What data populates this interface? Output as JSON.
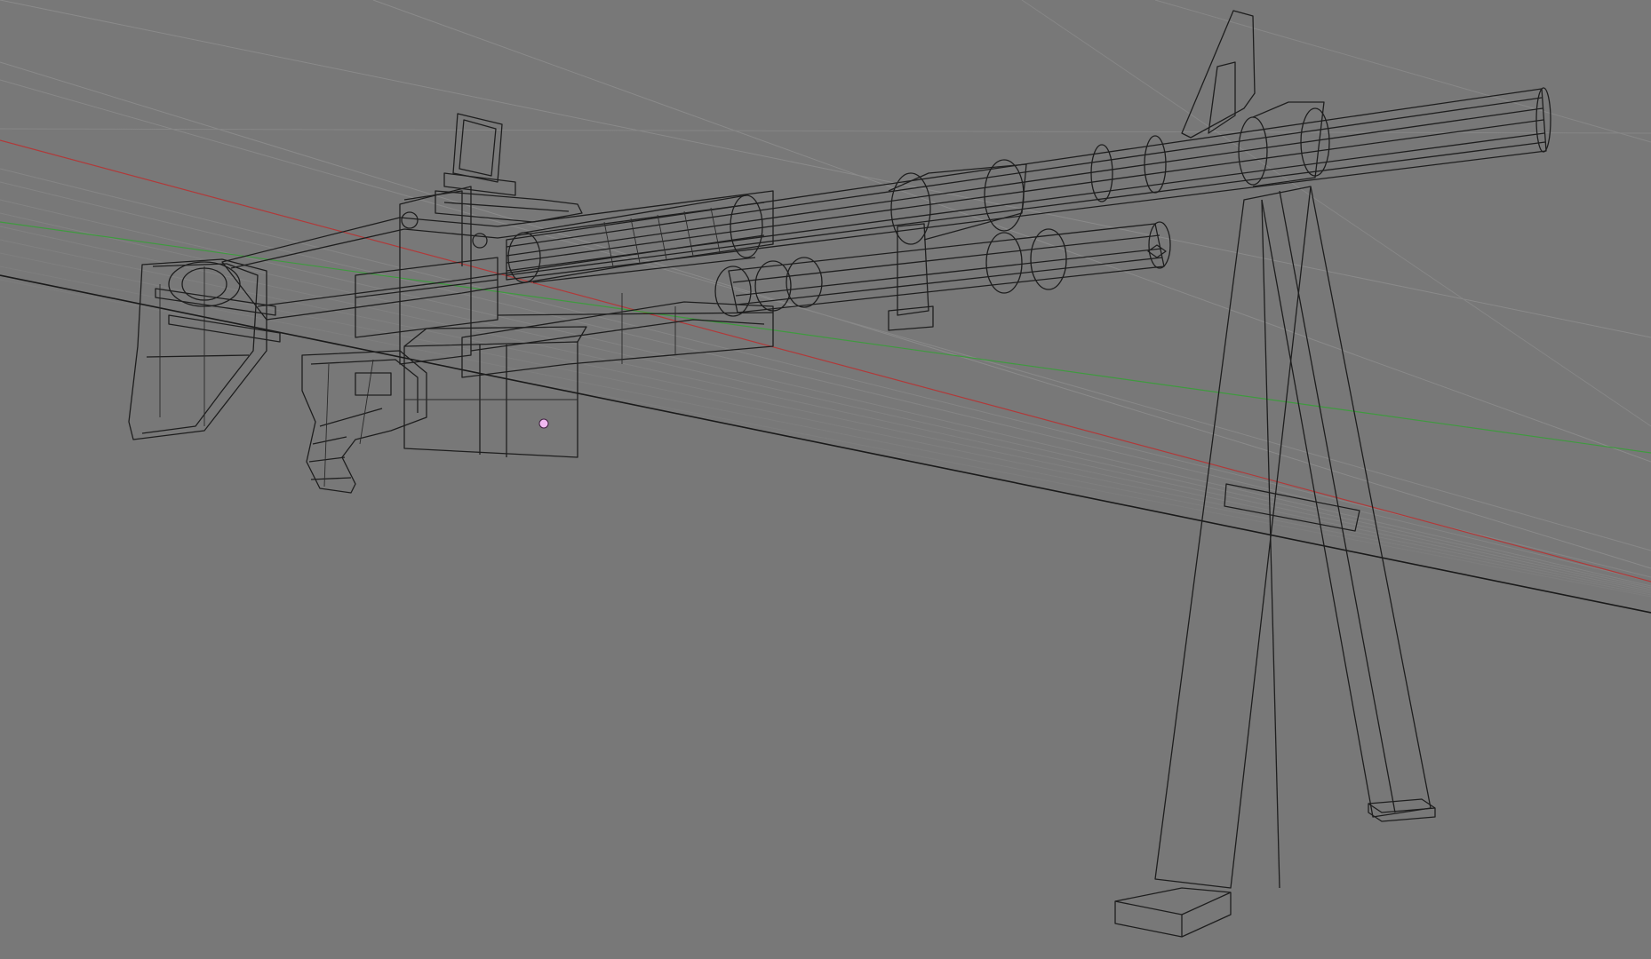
{
  "viewport": {
    "mode": "wireframe",
    "background_color": "#787878",
    "wire_color": "#1e1e1e",
    "axis_x_color": "#b03a3a",
    "axis_y_color": "#3f9a3f",
    "grid_color": "#8e8e8e",
    "horizon_color": "#1a1a1a",
    "origin_marker_color": "#f0b8f0"
  },
  "scene": {
    "objects": [
      {
        "name": "stock",
        "icon": "stock-mesh"
      },
      {
        "name": "receiver",
        "icon": "receiver-mesh"
      },
      {
        "name": "rear-sight",
        "icon": "sight-mesh"
      },
      {
        "name": "pistol-grip",
        "icon": "grip-mesh"
      },
      {
        "name": "magazine-box",
        "icon": "box-mesh"
      },
      {
        "name": "barrel",
        "icon": "barrel-mesh"
      },
      {
        "name": "gas-tube",
        "icon": "tube-mesh"
      },
      {
        "name": "front-sight",
        "icon": "sight-mesh"
      },
      {
        "name": "bipod",
        "icon": "bipod-mesh"
      }
    ]
  }
}
